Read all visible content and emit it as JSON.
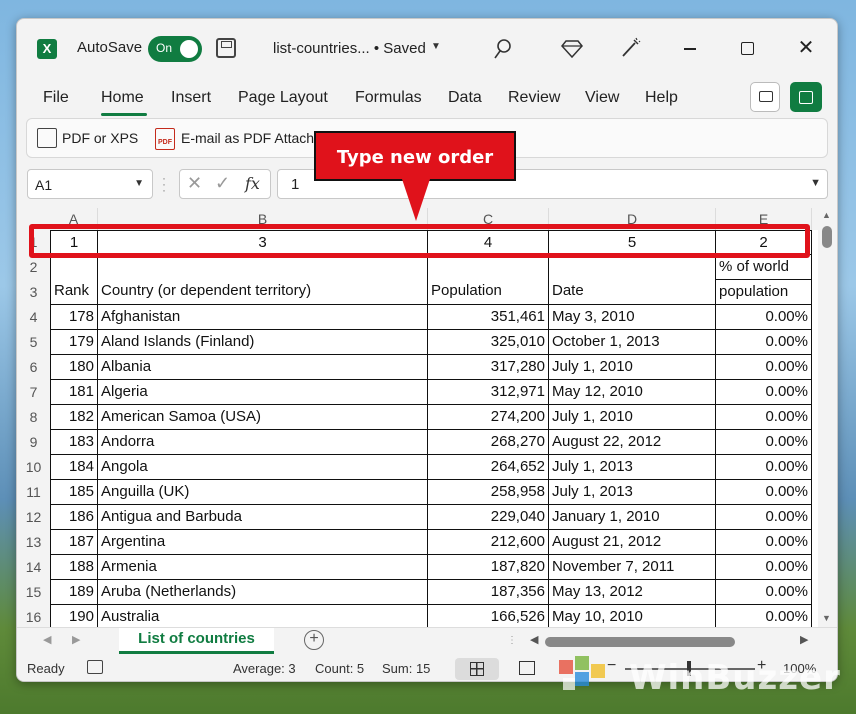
{
  "titlebar": {
    "autosave_label": "AutoSave",
    "autosave_state": "On",
    "filename": "list-countries... • Saved"
  },
  "menu": [
    "File",
    "Home",
    "Insert",
    "Page Layout",
    "Formulas",
    "Data",
    "Review",
    "View",
    "Help"
  ],
  "ribbon": {
    "pdf_label": "PDF or XPS",
    "email_label": "E-mail as PDF Attachment",
    "pdf_badge": "PDF"
  },
  "formula_bar": {
    "name_box": "A1",
    "value": "1"
  },
  "columns": [
    "A",
    "B",
    "C",
    "D",
    "E"
  ],
  "rows": [
    "1",
    "2",
    "3",
    "4",
    "5",
    "6",
    "7",
    "8",
    "9",
    "10",
    "11",
    "12",
    "13",
    "14",
    "15",
    "16"
  ],
  "order_row": [
    "1",
    "3",
    "4",
    "5",
    "2"
  ],
  "headers": {
    "rank": "Rank",
    "country": "Country (or dependent territory)",
    "population": "Population",
    "date": "Date",
    "pct_line1": "% of world",
    "pct_line2": "population"
  },
  "table": [
    [
      "178",
      "Afghanistan",
      "351,461",
      "May 3, 2010",
      "0.00%"
    ],
    [
      "179",
      "Aland Islands (Finland)",
      "325,010",
      "October 1, 2013",
      "0.00%"
    ],
    [
      "180",
      "Albania",
      "317,280",
      "July 1, 2010",
      "0.00%"
    ],
    [
      "181",
      "Algeria",
      "312,971",
      "May 12, 2010",
      "0.00%"
    ],
    [
      "182",
      "American Samoa (USA)",
      "274,200",
      "July 1, 2010",
      "0.00%"
    ],
    [
      "183",
      "Andorra",
      "268,270",
      "August 22, 2012",
      "0.00%"
    ],
    [
      "184",
      "Angola",
      "264,652",
      "July 1, 2013",
      "0.00%"
    ],
    [
      "185",
      "Anguilla (UK)",
      "258,958",
      "July 1, 2013",
      "0.00%"
    ],
    [
      "186",
      "Antigua and Barbuda",
      "229,040",
      "January 1, 2010",
      "0.00%"
    ],
    [
      "187",
      "Argentina",
      "212,600",
      "August 21, 2012",
      "0.00%"
    ],
    [
      "188",
      "Armenia",
      "187,820",
      "November 7, 2011",
      "0.00%"
    ],
    [
      "189",
      "Aruba (Netherlands)",
      "187,356",
      "May 13, 2012",
      "0.00%"
    ],
    [
      "190",
      "Australia",
      "166,526",
      "May 10, 2010",
      "0.00%"
    ]
  ],
  "sheet_tab": "List of countries",
  "status": {
    "ready": "Ready",
    "average": "Average: 3",
    "count": "Count: 5",
    "sum": "Sum: 15",
    "zoom": "100%"
  },
  "annotation": {
    "callout": "Type new order"
  },
  "watermark": "WinBuzzer",
  "colors": {
    "excel_green": "#107c41",
    "annotation_red": "#e0121b"
  }
}
